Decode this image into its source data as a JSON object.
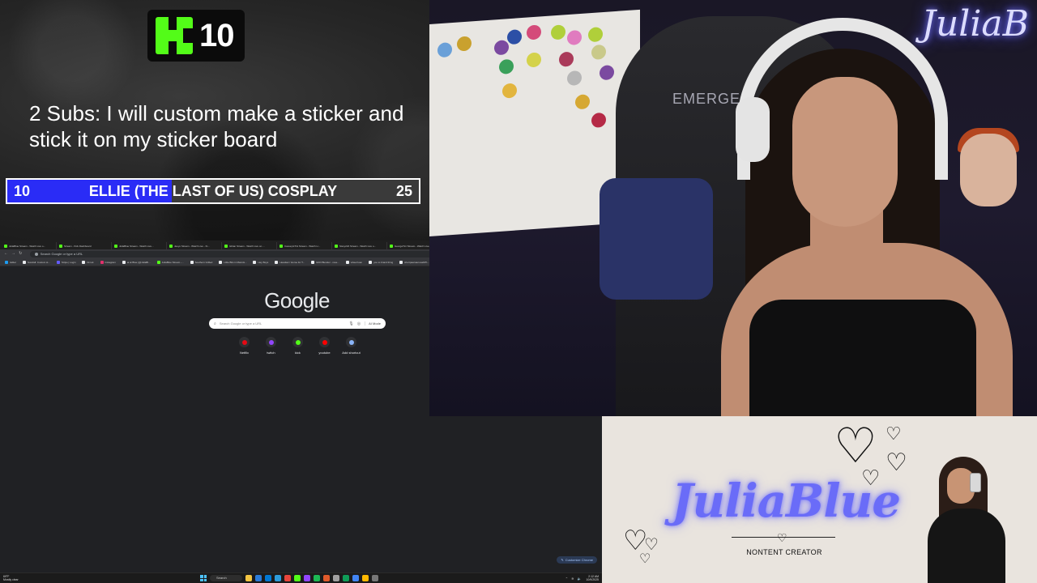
{
  "overlay": {
    "kick_count": "10",
    "goal_text": "2 Subs: I will custom make a sticker and stick it on my sticker board",
    "goal_bar": {
      "current": "10",
      "label": "ELLIE (THE LAST OF US) COSPLAY",
      "target": "25",
      "progress_fraction": 0.4
    }
  },
  "browser": {
    "tabs": [
      {
        "title": "JuliaBlue Stream - Watch Live o...",
        "color": "#53fc18"
      },
      {
        "title": "Stream - Kick Dashboard",
        "color": "#53fc18"
      },
      {
        "title": "JuliaBlue Stream - Watch Live...",
        "color": "#53fc18"
      },
      {
        "title": "Jeeyo Stream - Watch Live - Ki...",
        "color": "#53fc18"
      },
      {
        "title": "Ishtan Stream - Watch Live on ...",
        "color": "#53fc18"
      },
      {
        "title": "CasseyIsTini Stream - Watch Li...",
        "color": "#53fc18"
      },
      {
        "title": "Sissy222 Stream - Watch Live o...",
        "color": "#53fc18"
      },
      {
        "title": "GeorgeTini Stream - Watch Live...",
        "color": "#53fc18"
      },
      {
        "title": "New Tab",
        "color": "#9aa0a6"
      }
    ],
    "active_tab": 8,
    "omnibox_placeholder": "Search Google or type a URL",
    "bookmarks": [
      {
        "label": "twitter",
        "color": "#1d9bf0"
      },
      {
        "label": "Surefall: Custom st...",
        "color": "#e8eaed"
      },
      {
        "label": "Stripe | Login",
        "color": "#635bff"
      },
      {
        "label": "hk tok",
        "color": "#e8eaed"
      },
      {
        "label": "Instagram",
        "color": "#e1306c"
      },
      {
        "label": "ai at Blue (@JuliaBl...",
        "color": "#e8eaed"
      },
      {
        "label": "JuliaBlue Stream -...",
        "color": "#53fc18"
      },
      {
        "label": "Southern Grilled",
        "color": "#e8eaed"
      },
      {
        "label": "Little Bits in Mann&...",
        "color": "#e8eaed"
      },
      {
        "label": "Hey Boys",
        "color": "#e8eaed"
      },
      {
        "label": "Headset / Home for T...",
        "color": "#e8eaed"
      },
      {
        "label": "GKD Blender - rese...",
        "color": "#e8eaed"
      },
      {
        "label": "wheel loan",
        "color": "#e8eaed"
      },
      {
        "label": "you to brand thing",
        "color": "#e8eaed"
      },
      {
        "label": "shortpawsaurosabPh...",
        "color": "#e8eaed"
      },
      {
        "label": "tiles brand & thing",
        "color": "#e8eaed"
      },
      {
        "label": "vqtos",
        "color": "#e8eaed"
      },
      {
        "label": "Download the latest...",
        "color": "#ea4335"
      },
      {
        "label": "clip maker",
        "color": "#9146ff"
      }
    ],
    "all_bookmarks_label": "All Bookmarks",
    "top_links": [
      "Gmail",
      "Images"
    ],
    "google_logo": "Google",
    "search_placeholder": "Search Google or type a URL",
    "ai_mode_label": "AI Mode",
    "shortcuts": [
      {
        "label": "Netflix",
        "color": "#e50914"
      },
      {
        "label": "twitch",
        "color": "#9146ff"
      },
      {
        "label": "kick",
        "color": "#53fc18"
      },
      {
        "label": "youtube",
        "color": "#ff0000"
      },
      {
        "label": "Add shortcut",
        "color": "#8ab4f8"
      }
    ],
    "customize_label": "Customize Chrome"
  },
  "taskbar": {
    "weather_temp": "69°F",
    "weather_desc": "Mostly clear",
    "search_label": "Search",
    "apps": [
      "#f4c542",
      "#2b7bd8",
      "#0078d4",
      "#2d9cdb",
      "#e8453c",
      "#53fc18",
      "#9146ff",
      "#1db954",
      "#e05a2b",
      "#a0a0a0",
      "#0f9d58",
      "#4285f4",
      "#ffb900",
      "#777777"
    ],
    "time": "2:12 AM",
    "date": "10/9/2025"
  },
  "webcam": {
    "neon_sign": "JuliaB",
    "chair_brand": "EMERGE",
    "sticker_colors": [
      "#6aa0d8",
      "#c9a12e",
      "#7b4aa0",
      "#2c4fa6",
      "#d44b7a",
      "#b0cf3a",
      "#e07bbf",
      "#b0cf3a",
      "#3aa05a",
      "#d4d24a",
      "#aa3b5a",
      "#c9c98a",
      "#e2b53e",
      "#b7b7b7",
      "#7b4aa0",
      "#d6a832",
      "#b52a46"
    ]
  },
  "brand": {
    "name": "JuliaBlue",
    "tagline": "NONTENT CREATOR",
    "accent": "#6a6cf8"
  }
}
